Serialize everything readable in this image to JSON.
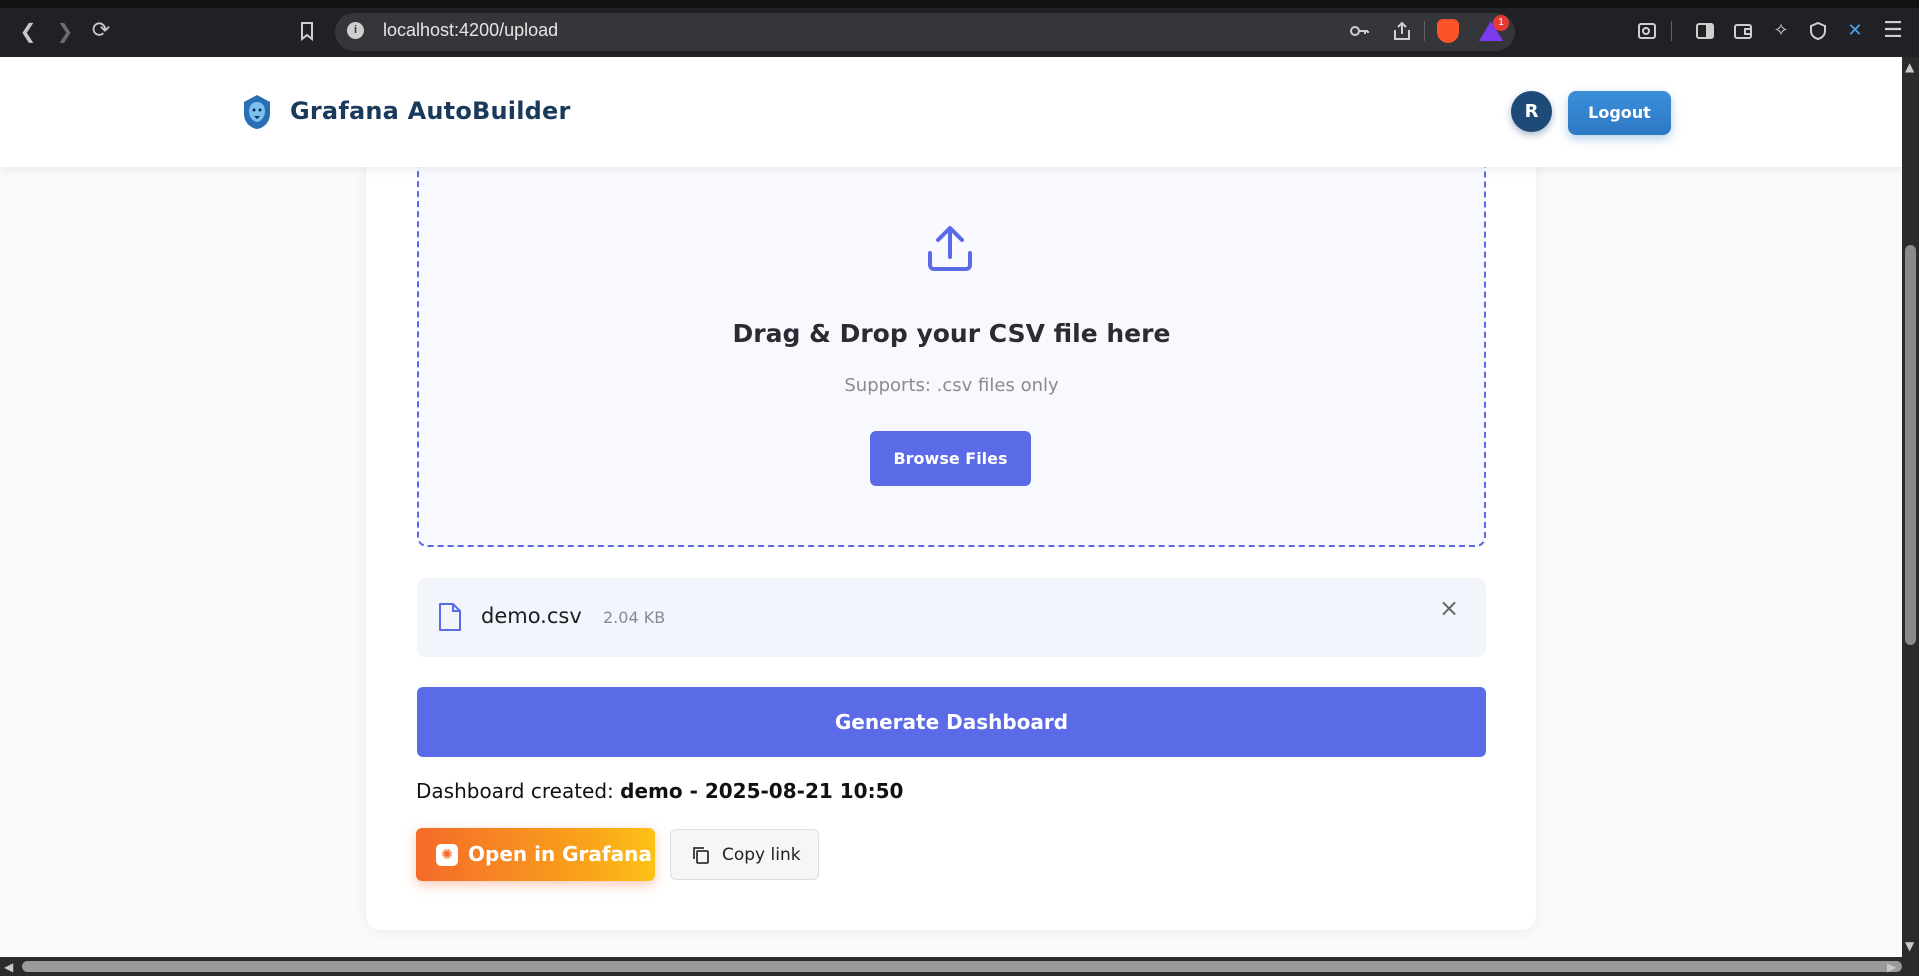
{
  "browser": {
    "url": "localhost:4200/upload",
    "extension_badge": "1"
  },
  "header": {
    "brand": "Grafana AutoBuilder",
    "avatar_initial": "R",
    "logout_label": "Logout"
  },
  "upload": {
    "title": "Drag & Drop your CSV file here",
    "subtitle": "Supports: .csv files only",
    "browse_label": "Browse Files"
  },
  "file": {
    "name": "demo.csv",
    "size": "2.04 KB"
  },
  "actions": {
    "generate_label": "Generate Dashboard",
    "created_prefix": "Dashboard created:",
    "created_name": "demo - 2025-08-21 10:50",
    "open_grafana_label": "Open in Grafana",
    "copy_link_label": "Copy link"
  },
  "colors": {
    "accent": "#5b6ae6",
    "brand_text": "#1a3a5c",
    "grafana_orange": "#f46a2a",
    "logout_blue": "#2e78c4"
  }
}
